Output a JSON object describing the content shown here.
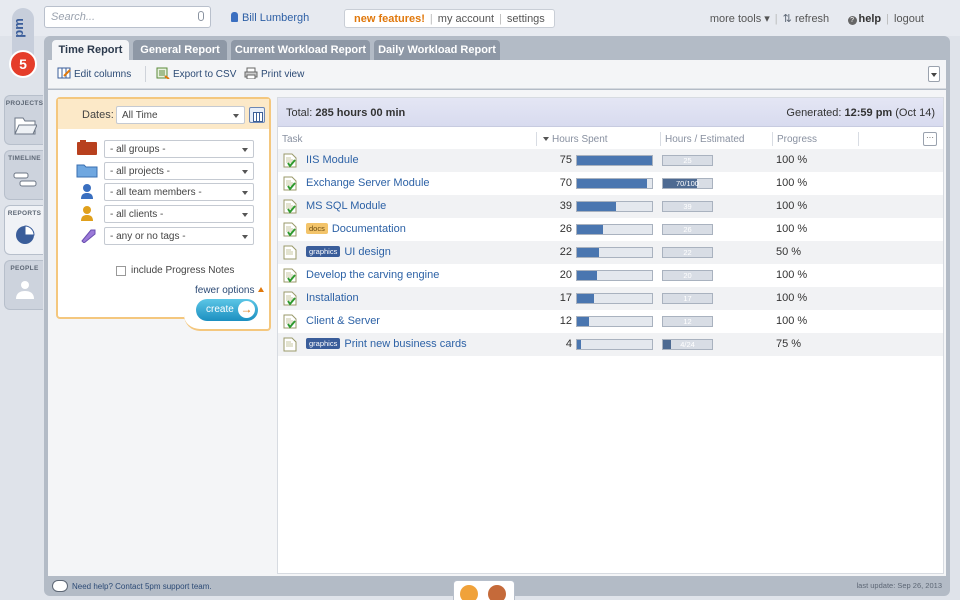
{
  "header": {
    "logo_text": "5pm",
    "search_placeholder": "Search...",
    "user_name": "Bill Lumbergh",
    "new_features": "new features!",
    "my_account": "my account",
    "settings": "settings",
    "more_tools": "more tools",
    "refresh": "refresh",
    "help": "help",
    "logout": "logout"
  },
  "sidenav": [
    {
      "label": "PROJECTS",
      "icon": "folder-icon"
    },
    {
      "label": "TIMELINE",
      "icon": "timeline-icon"
    },
    {
      "label": "REPORTS",
      "icon": "pie-chart-icon",
      "active": true
    },
    {
      "label": "PEOPLE",
      "icon": "people-icon"
    }
  ],
  "tabs": [
    "Time Report",
    "General Report",
    "Current Workload Report",
    "Daily Workload Report"
  ],
  "toolbar": {
    "edit_columns": "Edit columns",
    "export_csv": "Export to CSV",
    "print_view": "Print view"
  },
  "filters": {
    "dates_label": "Dates:",
    "dates_value": "All Time",
    "groups": "- all groups -",
    "projects": "- all projects -",
    "team_members": "- all team members -",
    "clients": "- all clients -",
    "tags": "- any or no tags -",
    "include_notes": "include Progress Notes",
    "fewer_options": "fewer options",
    "create": "create"
  },
  "report": {
    "total_label": "Total:",
    "total_value": "285 hours 00 min",
    "generated_label": "Generated:",
    "generated_time": "12:59 pm",
    "generated_date": "(Oct 14)",
    "columns": [
      "Task",
      "Hours Spent",
      "Hours / Estimated",
      "Progress"
    ],
    "rows": [
      {
        "task": "IIS Module",
        "badge": "",
        "hours": "75",
        "hours_frac": 1.0,
        "est": "25",
        "est_frac": 0.0,
        "progress": "100 %",
        "done": true
      },
      {
        "task": "Exchange Server Module",
        "badge": "",
        "hours": "70",
        "hours_frac": 0.93,
        "est": "70/100",
        "est_frac": 0.7,
        "progress": "100 %",
        "done": true
      },
      {
        "task": "MS SQL Module",
        "badge": "",
        "hours": "39",
        "hours_frac": 0.52,
        "est": "39",
        "est_frac": 0.0,
        "progress": "100 %",
        "done": true
      },
      {
        "task": "Documentation",
        "badge": "docs",
        "hours": "26",
        "hours_frac": 0.35,
        "est": "26",
        "est_frac": 0.0,
        "progress": "100 %",
        "done": true
      },
      {
        "task": "UI design",
        "badge": "graphics",
        "hours": "22",
        "hours_frac": 0.29,
        "est": "22",
        "est_frac": 0.0,
        "progress": "50 %",
        "done": false
      },
      {
        "task": "Develop the carving engine",
        "badge": "",
        "hours": "20",
        "hours_frac": 0.27,
        "est": "20",
        "est_frac": 0.0,
        "progress": "100 %",
        "done": true
      },
      {
        "task": "Installation",
        "badge": "",
        "hours": "17",
        "hours_frac": 0.23,
        "est": "17",
        "est_frac": 0.0,
        "progress": "100 %",
        "done": true
      },
      {
        "task": "Client & Server",
        "badge": "",
        "hours": "12",
        "hours_frac": 0.16,
        "est": "12",
        "est_frac": 0.0,
        "progress": "100 %",
        "done": true
      },
      {
        "task": "Print new business cards",
        "badge": "graphics",
        "hours": "4",
        "hours_frac": 0.05,
        "est": "4/24",
        "est_frac": 0.17,
        "progress": "75 %",
        "done": false
      }
    ]
  },
  "footer": {
    "help_text": "Need help? Contact 5pm support team.",
    "last_update": "last update: Sep 26, 2013"
  },
  "colors": {
    "accent": "#e0780c",
    "link": "#2d62a6",
    "bar": "#4a76b0",
    "docs_badge": "#f3c46a",
    "graphics_badge": "#3a5d9a"
  }
}
